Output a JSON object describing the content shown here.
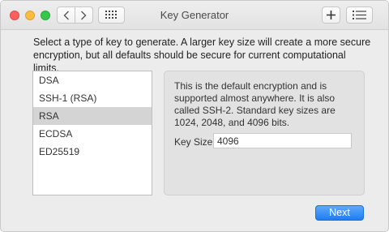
{
  "window": {
    "title": "Key Generator"
  },
  "toolbar": {
    "back_icon": "chevron-left-icon",
    "forward_icon": "chevron-right-icon",
    "grid_icon": "grid-icon",
    "add_icon": "plus-icon",
    "list_icon": "list-icon"
  },
  "instructions": "Select a type of key to generate. A larger key size will create a more secure encryption, but all defaults should be secure for current computational limits.",
  "key_types": [
    {
      "label": "DSA",
      "selected": false
    },
    {
      "label": "SSH-1 (RSA)",
      "selected": false
    },
    {
      "label": "RSA",
      "selected": true
    },
    {
      "label": "ECDSA",
      "selected": false
    },
    {
      "label": "ED25519",
      "selected": false
    }
  ],
  "detail": {
    "description": "This is the default encryption and is supported almost anywhere. It is also called SSH-2. Standard key sizes are 1024, 2048, and 4096 bits.",
    "key_size_label": "Key Size:",
    "key_size_value": "4096"
  },
  "next_button_label": "Next",
  "colors": {
    "accent": "#1e7df2",
    "selected_row": "#d4d4d4",
    "close": "#fc605c",
    "minimize": "#fdbc40",
    "maximize": "#34c84a"
  }
}
